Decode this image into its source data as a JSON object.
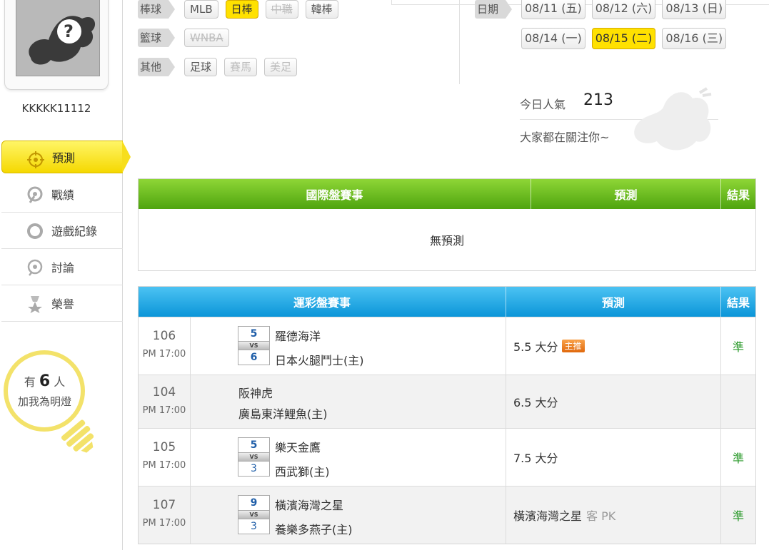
{
  "user": {
    "name": "KKKKK11112"
  },
  "nav": [
    {
      "label": "預測",
      "icon": "target-icon",
      "active": true
    },
    {
      "label": "戰績",
      "icon": "record-icon"
    },
    {
      "label": "遊戲紀錄",
      "icon": "history-icon"
    },
    {
      "label": "討論",
      "icon": "chat-icon"
    },
    {
      "label": "榮譽",
      "icon": "medal-icon"
    }
  ],
  "bulb": {
    "prefix": "有",
    "count": "6",
    "suffix": "人",
    "line2": "加我為明燈"
  },
  "filters": {
    "baseball": {
      "label": "棒球",
      "chips": [
        "MLB",
        "日棒",
        "中職",
        "韓棒"
      ]
    },
    "basketball": {
      "label": "籃球",
      "chips": [
        "WNBA"
      ]
    },
    "other": {
      "label": "其他",
      "chips": [
        "足球",
        "賽馬",
        "美足"
      ]
    }
  },
  "dates": {
    "label": "日期",
    "row1": [
      "08/11 (五)",
      "08/12 (六)",
      "08/13 (日)"
    ],
    "row2": [
      "08/14 (一)",
      "08/15 (二)",
      "08/16 (三)"
    ]
  },
  "stats": {
    "popularity_label": "今日人氣",
    "popularity_value": "213",
    "follow_text": "大家都在關注你~"
  },
  "intl_table": {
    "headers": [
      "國際盤賽事",
      "預測",
      "結果"
    ],
    "empty": "無預測"
  },
  "lottery_table": {
    "headers": [
      "運彩盤賽事",
      "預測",
      "結果"
    ],
    "rows": [
      {
        "num": "106",
        "time": "PM 17:00",
        "away": "羅德海洋",
        "home": "日本火腿鬥士(主)",
        "away_score": "5",
        "home_score": "6",
        "vs": "VS",
        "prediction": "5.5 大分",
        "badge": "主推",
        "result": "準"
      },
      {
        "num": "104",
        "time": "PM 17:00",
        "away": "阪神虎",
        "home": "廣島東洋鯉魚(主)",
        "prediction": "6.5 大分",
        "result": ""
      },
      {
        "num": "105",
        "time": "PM 17:00",
        "away": "樂天金鷹",
        "home": "西武獅(主)",
        "away_score": "5",
        "home_score": "3",
        "vs": "VS",
        "prediction": "7.5 大分",
        "result": "準"
      },
      {
        "num": "107",
        "time": "PM 17:00",
        "away": "橫濱海灣之星",
        "home": "養樂多燕子(主)",
        "away_score": "9",
        "home_score": "3",
        "vs": "VS",
        "prediction": "橫濱海灣之星",
        "prediction_extra": "客 PK",
        "result": "準"
      }
    ]
  },
  "colors": {
    "accent_yellow": "#ffe100",
    "green_header": "#4fa40f",
    "blue_header": "#0b95d8",
    "result_green": "#2a9a2a"
  }
}
